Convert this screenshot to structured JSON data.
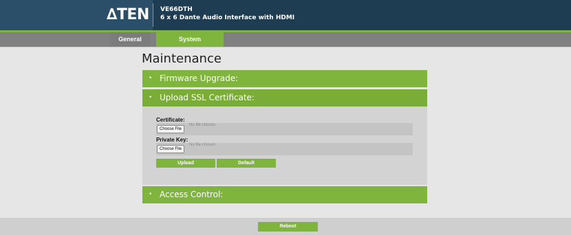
{
  "header": {
    "logo": "∆TEN",
    "model": "VE66DTH",
    "description": "6 x 6 Dante Audio Interface with HDMI"
  },
  "nav": {
    "tabs": [
      {
        "label": "General",
        "active": false
      },
      {
        "label": "System",
        "active": true
      }
    ]
  },
  "page": {
    "title": "Maintenance",
    "sections": {
      "firmware": {
        "bullet": "•",
        "label": "Firmware Upgrade:"
      },
      "ssl": {
        "bullet": "•",
        "label": "Upload SSL Certificate:",
        "certificate_label": "Certificate:",
        "private_key_label": "Private Key:",
        "choose_file": "Choose File",
        "no_file": "No file chosen",
        "upload": "Upload",
        "default": "Default"
      },
      "access": {
        "bullet": "•",
        "label": "Access Control:"
      }
    }
  },
  "footer": {
    "reboot": "Reboot"
  },
  "colors": {
    "accent_green": "#7fb53c",
    "header_navy": "#1f3d52",
    "nav_gray": "#808080",
    "page_bg": "#e6e6e6"
  }
}
